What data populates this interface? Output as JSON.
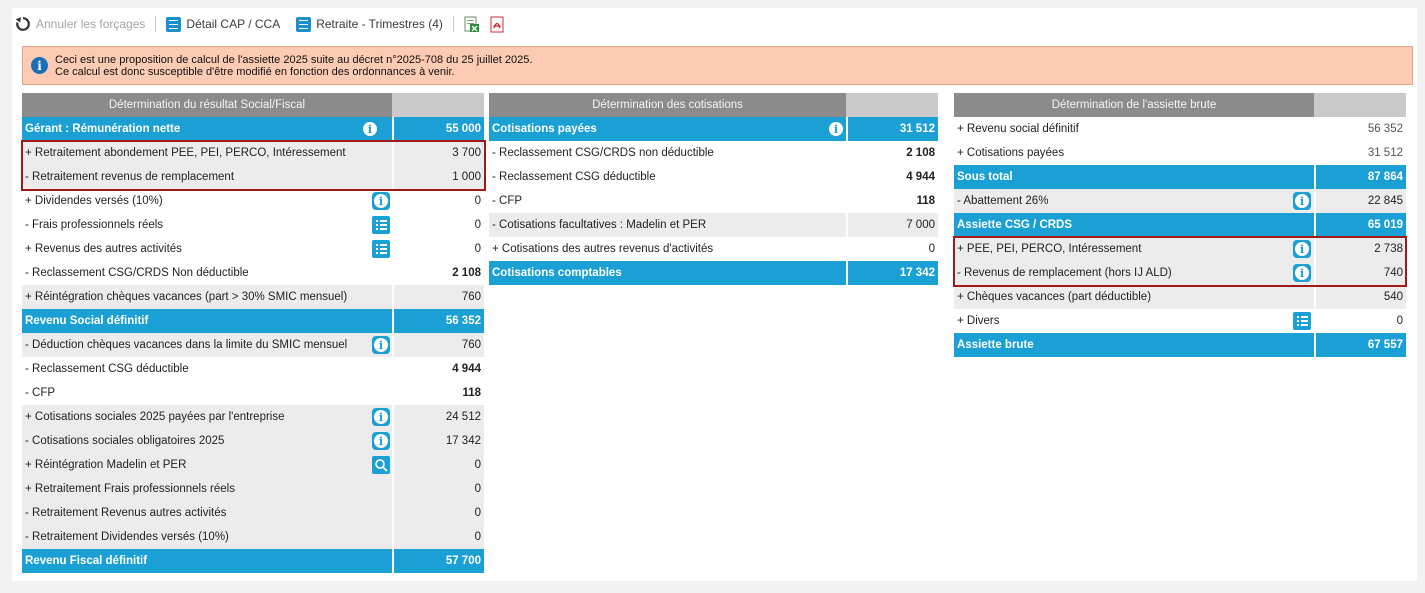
{
  "toolbar": {
    "undo_label": "Annuler les forçages",
    "detail_label": "Détail CAP / CCA",
    "retraite_label": "Retraite - Trimestres (4)",
    "excel_icon": "excel-export-icon",
    "pdf_icon": "pdf-export-icon"
  },
  "notice": {
    "line1": "Ceci est une proposition de calcul de l'assiette 2025 suite au décret n°2025-708 du 25 juillet 2025.",
    "line2": "Ce calcul est donc susceptible d'être modifié en fonction des ordonnances à venir."
  },
  "colors": {
    "blue": "#1aa0d4",
    "header_grey": "#8b8b8b",
    "row_grey": "#ececec",
    "notice_bg": "#fdcab4",
    "highlight_border": "#9b1b1b"
  },
  "table1": {
    "title": "Détermination du résultat Social/Fiscal",
    "rows": [
      {
        "label": "Gérant : Rémunération nette",
        "value": "55 000"
      },
      {
        "label": "+ Retraitement abondement PEE, PEI, PERCO, Intéressement",
        "value": "3 700"
      },
      {
        "label": "- Retraitement revenus de remplacement",
        "value": "1 000"
      },
      {
        "label": "+ Dividendes versés (10%)",
        "value": "0"
      },
      {
        "label": "- Frais professionnels réels",
        "value": "0"
      },
      {
        "label": "+ Revenus des autres activités",
        "value": "0"
      },
      {
        "label": "- Reclassement CSG/CRDS Non déductible",
        "value": "2 108"
      },
      {
        "label": "+ Réintégration chèques vacances (part > 30% SMIC mensuel)",
        "value": "760"
      },
      {
        "label": "Revenu Social définitif",
        "value": "56 352"
      },
      {
        "label": "- Déduction chèques vacances dans la limite du SMIC mensuel",
        "value": "760"
      },
      {
        "label": "- Reclassement CSG déductible",
        "value": "4 944"
      },
      {
        "label": "- CFP",
        "value": "118"
      },
      {
        "label": "+ Cotisations sociales 2025 payées par l'entreprise",
        "value": "24 512"
      },
      {
        "label": "- Cotisations sociales obligatoires 2025",
        "value": "17 342"
      },
      {
        "label": "+ Réintégration Madelin et PER",
        "value": "0"
      },
      {
        "label": "+ Retraitement Frais professionnels réels",
        "value": "0"
      },
      {
        "label": "- Retraitement Revenus autres activités",
        "value": "0"
      },
      {
        "label": "- Retraitement Dividendes versés (10%)",
        "value": "0"
      },
      {
        "label": "Revenu Fiscal définitif",
        "value": "57 700"
      }
    ]
  },
  "table2": {
    "title": "Détermination des cotisations",
    "rows": [
      {
        "label": "Cotisations payées",
        "value": "31 512"
      },
      {
        "label": "- Reclassement CSG/CRDS non déductible",
        "value": "2 108"
      },
      {
        "label": "- Reclassement CSG déductible",
        "value": "4 944"
      },
      {
        "label": "- CFP",
        "value": "118"
      },
      {
        "label": "- Cotisations facultatives : Madelin et PER",
        "value": "7 000"
      },
      {
        "label": "+ Cotisations des autres revenus d'activités",
        "value": "0"
      },
      {
        "label": "Cotisations comptables",
        "value": "17 342"
      }
    ]
  },
  "table3": {
    "title": "Détermination de l'assiette brute",
    "rows": [
      {
        "label": "+ Revenu social définitif",
        "value": "56 352"
      },
      {
        "label": "+ Cotisations payées",
        "value": "31 512"
      },
      {
        "label": "Sous total",
        "value": "87 864"
      },
      {
        "label": "- Abattement 26%",
        "value": "22 845"
      },
      {
        "label": "Assiette CSG / CRDS",
        "value": "65 019"
      },
      {
        "label": "+ PEE, PEI, PERCO, Intéressement",
        "value": "2 738"
      },
      {
        "label": "- Revenus de remplacement (hors IJ ALD)",
        "value": "740"
      },
      {
        "label": "+ Chèques vacances (part déductible)",
        "value": "540"
      },
      {
        "label": "+ Divers",
        "value": "0"
      },
      {
        "label": "Assiette brute",
        "value": "67 557"
      }
    ]
  }
}
